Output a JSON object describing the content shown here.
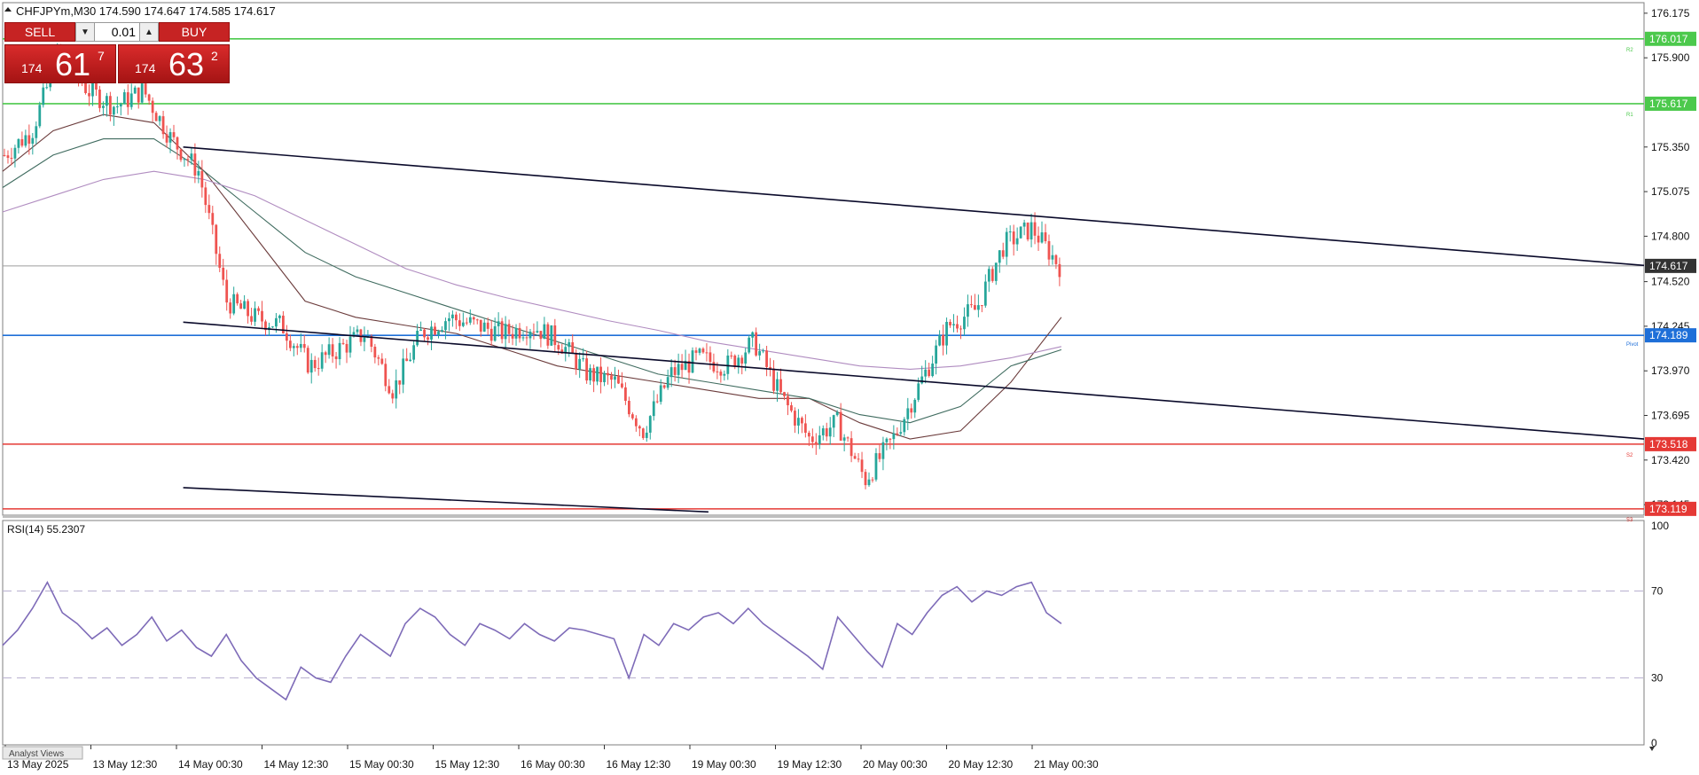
{
  "header": {
    "symbol_info": "CHFJPYm,M30  174.590 174.647 174.585 174.617"
  },
  "trade_panel": {
    "sell_label": "SELL",
    "buy_label": "BUY",
    "volume": "0.01",
    "sell_price_big": "174",
    "sell_price_large": "61",
    "sell_price_sup": "7",
    "buy_price_big": "174",
    "buy_price_large": "63",
    "buy_price_sup": "2"
  },
  "rsi_label": "RSI(14) 55.2307",
  "footer_tab": "Analyst Views",
  "colors": {
    "bull": "#26a69a",
    "bear": "#ef5350",
    "pivot": "#1e6fd8",
    "resistance": "#4cc94c",
    "support": "#e53935",
    "rsi": "#7e6bb8",
    "trendline": "#0a0a2a",
    "current": "#333333"
  },
  "chart_data": [
    {
      "type": "candlestick",
      "title": "CHFJPYm,M30",
      "ohlc": {
        "open": 174.59,
        "high": 174.647,
        "low": 174.585,
        "close": 174.617
      },
      "y_ticks": [
        176.175,
        175.9,
        175.35,
        175.075,
        174.8,
        174.52,
        174.245,
        173.97,
        173.695,
        173.42,
        173.145
      ],
      "x_ticks": [
        "13 May 2025",
        "13 May 12:30",
        "14 May 00:30",
        "14 May 12:30",
        "15 May 00:30",
        "15 May 12:30",
        "16 May 00:30",
        "16 May 12:30",
        "19 May 00:30",
        "19 May 12:30",
        "20 May 00:30",
        "20 May 12:30",
        "21 May 00:30"
      ],
      "ylim": [
        173.08,
        176.24
      ],
      "current_price": "174.617",
      "levels": [
        {
          "name": "R2",
          "price": "176.017",
          "kind": "resistance"
        },
        {
          "name": "R1",
          "price": "175.617",
          "kind": "resistance"
        },
        {
          "name": "Pivot",
          "price": "174.189",
          "kind": "pivot"
        },
        {
          "name": "S2",
          "price": "173.518",
          "kind": "support"
        },
        {
          "name": "S3",
          "price": "173.119",
          "kind": "support"
        }
      ],
      "trendlines": [
        {
          "from": [
            0.11,
            175.35
          ],
          "to": [
            1.0,
            174.62
          ]
        },
        {
          "from": [
            0.11,
            174.27
          ],
          "to": [
            1.0,
            173.55
          ]
        },
        {
          "from": [
            0.11,
            173.25
          ],
          "to": [
            0.43,
            173.1
          ]
        }
      ],
      "price_path": [
        175.3,
        175.45,
        175.95,
        175.7,
        175.6,
        175.7,
        175.4,
        175.2,
        174.4,
        174.3,
        174.25,
        174.0,
        174.1,
        174.2,
        173.85,
        174.2,
        174.3,
        174.25,
        174.2,
        174.25,
        174.15,
        173.95,
        173.9,
        173.6,
        173.95,
        174.05,
        174.0,
        174.15,
        173.8,
        173.55,
        173.65,
        173.3,
        173.55,
        173.9,
        174.25,
        174.35,
        174.75,
        174.85,
        174.617
      ],
      "ma_curves": [
        {
          "name": "ma_fast",
          "values": [
            175.2,
            175.45,
            175.55,
            175.5,
            175.2,
            174.8,
            174.4,
            174.3,
            174.25,
            174.2,
            174.1,
            174.0,
            173.95,
            173.9,
            173.85,
            173.8,
            173.8,
            173.65,
            173.55,
            173.6,
            173.9,
            174.3
          ]
        },
        {
          "name": "ma_mid",
          "values": [
            175.1,
            175.3,
            175.4,
            175.4,
            175.2,
            174.95,
            174.7,
            174.55,
            174.45,
            174.35,
            174.25,
            174.15,
            174.05,
            173.95,
            173.9,
            173.85,
            173.8,
            173.7,
            173.65,
            173.75,
            174.0,
            174.1
          ]
        },
        {
          "name": "ma_slow",
          "values": [
            174.95,
            175.05,
            175.15,
            175.2,
            175.15,
            175.05,
            174.9,
            174.75,
            174.6,
            174.5,
            174.42,
            174.35,
            174.28,
            174.22,
            174.15,
            174.1,
            174.05,
            174.0,
            173.98,
            174.0,
            174.05,
            174.12
          ]
        }
      ]
    },
    {
      "type": "line",
      "title": "RSI(14)",
      "value": 55.2307,
      "y_ticks": [
        100,
        70,
        30,
        0
      ],
      "ylim": [
        0,
        100
      ],
      "levels": [
        70,
        30
      ],
      "values": [
        45,
        52,
        62,
        74,
        60,
        55,
        48,
        53,
        45,
        50,
        58,
        47,
        52,
        44,
        40,
        50,
        38,
        30,
        25,
        20,
        35,
        30,
        28,
        40,
        50,
        45,
        40,
        55,
        62,
        58,
        50,
        45,
        55,
        52,
        48,
        55,
        50,
        47,
        53,
        52,
        50,
        48,
        30,
        50,
        45,
        55,
        52,
        58,
        60,
        55,
        62,
        55,
        50,
        45,
        40,
        34,
        58,
        50,
        42,
        35,
        55,
        50,
        60,
        68,
        72,
        65,
        70,
        68,
        72,
        74,
        60,
        55
      ]
    }
  ]
}
